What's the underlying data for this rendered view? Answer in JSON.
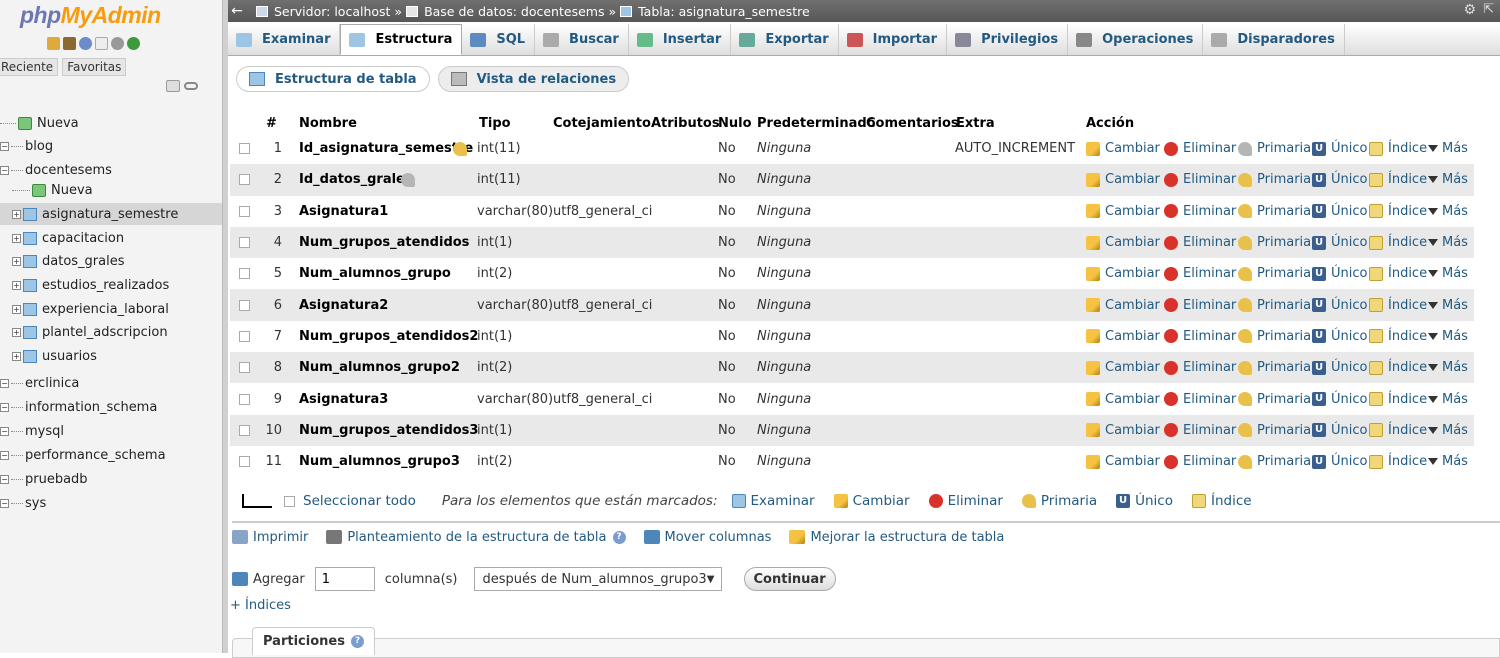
{
  "sidebar": {
    "logo_php": "php",
    "logo_my": "MyAdmin",
    "tabs": [
      "Reciente",
      "Favoritas"
    ],
    "tree": [
      {
        "label": "Nueva",
        "kind": "new",
        "level": 0
      },
      {
        "label": "blog",
        "kind": "db",
        "level": 0
      },
      {
        "label": "docentesems",
        "kind": "db",
        "level": 0
      },
      {
        "label": "Nueva",
        "kind": "new",
        "level": 1
      },
      {
        "label": "asignatura_semestre",
        "kind": "table",
        "level": 1,
        "active": true
      },
      {
        "label": "capacitacion",
        "kind": "table",
        "level": 1
      },
      {
        "label": "datos_grales",
        "kind": "table",
        "level": 1
      },
      {
        "label": "estudios_realizados",
        "kind": "table",
        "level": 1
      },
      {
        "label": "experiencia_laboral",
        "kind": "table",
        "level": 1
      },
      {
        "label": "plantel_adscripcion",
        "kind": "table",
        "level": 1
      },
      {
        "label": "usuarios",
        "kind": "table",
        "level": 1
      },
      {
        "label": "erclinica",
        "kind": "db",
        "level": 0
      },
      {
        "label": "information_schema",
        "kind": "db",
        "level": 0
      },
      {
        "label": "mysql",
        "kind": "db",
        "level": 0
      },
      {
        "label": "performance_schema",
        "kind": "db",
        "level": 0
      },
      {
        "label": "pruebadb",
        "kind": "db",
        "level": 0
      },
      {
        "label": "sys",
        "kind": "db",
        "level": 0
      }
    ]
  },
  "breadcrumb": {
    "server": "Servidor: localhost »",
    "database": "Base de datos: docentesems »",
    "table": "Tabla: asignatura_semestre"
  },
  "tabs": [
    "Examinar",
    "Estructura",
    "SQL",
    "Buscar",
    "Insertar",
    "Exportar",
    "Importar",
    "Privilegios",
    "Operaciones",
    "Disparadores"
  ],
  "active_tab": "Estructura",
  "subtabs": [
    "Estructura de tabla",
    "Vista de relaciones"
  ],
  "columns": {
    "num": "#",
    "name": "Nombre",
    "type": "Tipo",
    "collation": "Cotejamiento",
    "attributes": "Atributos",
    "null": "Nulo",
    "default": "Predeterminado",
    "comments": "Comentarios",
    "extra": "Extra",
    "action": "Acción"
  },
  "actions": [
    "Cambiar",
    "Eliminar",
    "Primaria",
    "Único",
    "Índice",
    "Más"
  ],
  "rows": [
    {
      "num": "1",
      "name": "Id_asignatura_semestre",
      "key": "primary",
      "type": "int(11)",
      "collation": "",
      "null": "No",
      "default": "Ninguna",
      "extra": "AUTO_INCREMENT"
    },
    {
      "num": "2",
      "name": "Id_datos_grales",
      "key": "index",
      "type": "int(11)",
      "collation": "",
      "null": "No",
      "default": "Ninguna",
      "extra": ""
    },
    {
      "num": "3",
      "name": "Asignatura1",
      "key": "",
      "type": "varchar(80)",
      "collation": "utf8_general_ci",
      "null": "No",
      "default": "Ninguna",
      "extra": ""
    },
    {
      "num": "4",
      "name": "Num_grupos_atendidos",
      "key": "",
      "type": "int(1)",
      "collation": "",
      "null": "No",
      "default": "Ninguna",
      "extra": ""
    },
    {
      "num": "5",
      "name": "Num_alumnos_grupo",
      "key": "",
      "type": "int(2)",
      "collation": "",
      "null": "No",
      "default": "Ninguna",
      "extra": ""
    },
    {
      "num": "6",
      "name": "Asignatura2",
      "key": "",
      "type": "varchar(80)",
      "collation": "utf8_general_ci",
      "null": "No",
      "default": "Ninguna",
      "extra": ""
    },
    {
      "num": "7",
      "name": "Num_grupos_atendidos2",
      "key": "",
      "type": "int(1)",
      "collation": "",
      "null": "No",
      "default": "Ninguna",
      "extra": ""
    },
    {
      "num": "8",
      "name": "Num_alumnos_grupo2",
      "key": "",
      "type": "int(2)",
      "collation": "",
      "null": "No",
      "default": "Ninguna",
      "extra": ""
    },
    {
      "num": "9",
      "name": "Asignatura3",
      "key": "",
      "type": "varchar(80)",
      "collation": "utf8_general_ci",
      "null": "No",
      "default": "Ninguna",
      "extra": ""
    },
    {
      "num": "10",
      "name": "Num_grupos_atendidos3",
      "key": "",
      "type": "int(1)",
      "collation": "",
      "null": "No",
      "default": "Ninguna",
      "extra": ""
    },
    {
      "num": "11",
      "name": "Num_alumnos_grupo3",
      "key": "",
      "type": "int(2)",
      "collation": "",
      "null": "No",
      "default": "Ninguna",
      "extra": ""
    }
  ],
  "bulk": {
    "select_all": "Seleccionar todo",
    "marked_label": "Para los elementos que están marcados:",
    "actions": [
      "Examinar",
      "Cambiar",
      "Eliminar",
      "Primaria",
      "Único",
      "Índice"
    ]
  },
  "tools": [
    "Imprimir",
    "Planteamiento de la estructura de tabla",
    "Mover columnas",
    "Mejorar la estructura de tabla"
  ],
  "add_columns": {
    "label": "Agregar",
    "count": "1",
    "unit": "columna(s)",
    "position": "después de Num_alumnos_grupo3",
    "submit": "Continuar"
  },
  "add_index": "+ Índices",
  "partitions_title": "Particiones",
  "colors": {
    "link": "#235a81",
    "row_alt": "#e9e9e9",
    "topbar": "#626262"
  }
}
